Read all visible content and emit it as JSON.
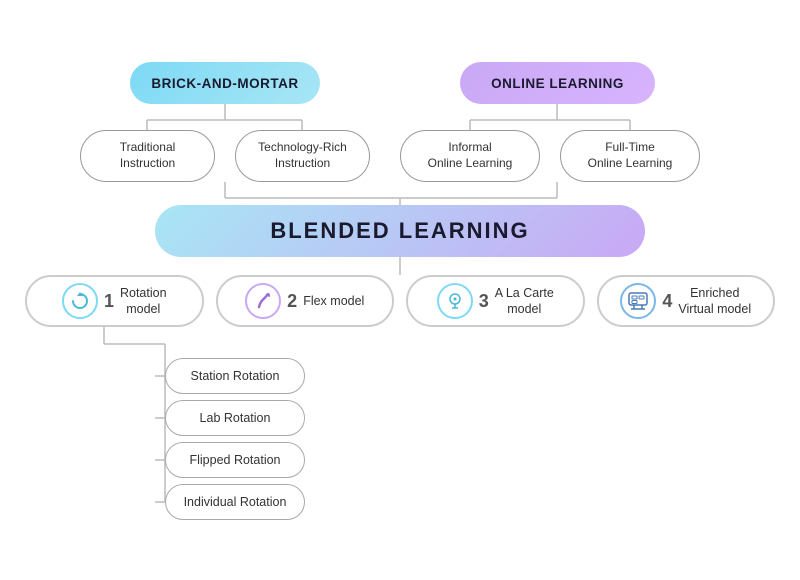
{
  "nodes": {
    "brick_mortar": "BRICK-AND-MORTAR",
    "online_learning": "ONLINE LEARNING",
    "trad_instruction": "Traditional\nInstruction",
    "tech_instruction": "Technology-Rich\nInstruction",
    "informal_online": "Informal\nOnline Learning",
    "fulltime_online": "Full-Time\nOnline Learning",
    "blended_learning": "BLENDED LEARNING",
    "model1_num": "1",
    "model1_label": "Rotation\nmodel",
    "model2_num": "2",
    "model2_label": "Flex model",
    "model3_num": "3",
    "model3_label": "A La Carte\nmodel",
    "model4_num": "4",
    "model4_label": "Enriched\nVirtual model",
    "station_rotation": "Station Rotation",
    "lab_rotation": "Lab Rotation",
    "flipped_rotation": "Flipped Rotation",
    "individual_rotation": "Individual Rotation"
  },
  "icons": {
    "rotation": "↻",
    "flex": "∫",
    "carte": "🧠",
    "virtual": "🖥"
  }
}
